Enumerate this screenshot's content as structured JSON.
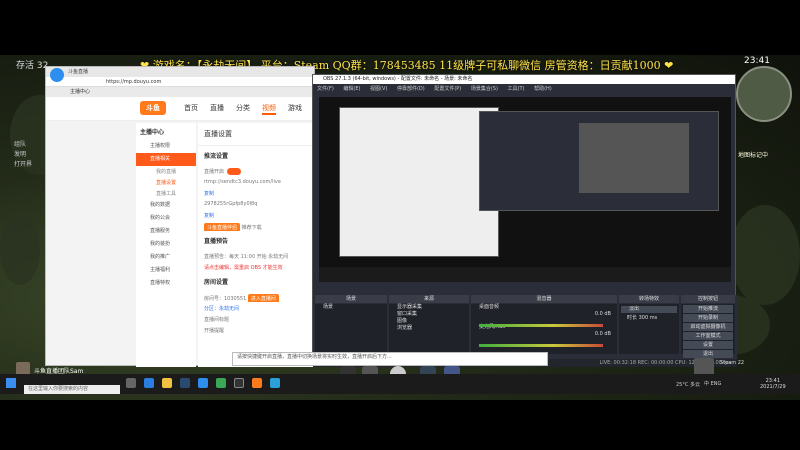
{
  "overlay": {
    "banner": "❤ 游戏名：【永劫无间】 平台：Steam QQ群：178453485 11级牌子可私聊微信 房管资格：日贡献1000 ❤"
  },
  "hud": {
    "top_left": "存活 32",
    "clock": "23:41",
    "right_note": "地图标记中",
    "left_lines": [
      "组队",
      "发明",
      "打开界"
    ]
  },
  "browser": {
    "title": "斗鱼直播",
    "url": "https://mp.douyu.com",
    "tab": "主播中心",
    "nav": [
      "首页",
      "直播",
      "分类",
      "视频",
      "游戏"
    ],
    "active_nav_index": 3,
    "logo": "斗鱼",
    "side_title": "主播中心",
    "side_items": [
      "主播权限",
      "直播相关",
      "我的数据",
      "我的公会",
      "直播服务",
      "我的装扮",
      "我的推广",
      "主播福利",
      "直播特权"
    ],
    "side_subs": [
      "我的直播",
      "直播设置",
      "直播工具"
    ],
    "content_title": "直播设置",
    "sec1": "推流设置",
    "rows": [
      "直播开启",
      "rtmp://sendtc3.douyu.com/live",
      "复制",
      "2978255rGpfp8y0l8q",
      "复制",
      "斗鱼直播伴侣",
      "推荐下载"
    ],
    "sec2": "直播预告",
    "row2": "直播预告：每天 11:00 开始 永劫无间",
    "warn": "请点击编辑，需重启 OBS 才能生效",
    "sec3": "房间设置",
    "row3a": "房间号：1030551",
    "btn3": "进入直播间",
    "row3b": "分区：永劫无间",
    "row3c": "直播间标题",
    "row3d": "开播提醒"
  },
  "obs": {
    "title": "OBS 27.1.3 (64-bit, windows) - 配置文件: 未命名 - 场景: 未命名",
    "menu": [
      "文件(F)",
      "编辑(E)",
      "视图(V)",
      "停靠部件(D)",
      "配置文件(P)",
      "场景集合(S)",
      "工具(T)",
      "帮助(H)"
    ],
    "docks": [
      "场景",
      "来源",
      "混音器",
      "转场特效",
      "控制按钮"
    ],
    "scene": "场景",
    "sources": [
      "显示器采集",
      "窗口采集",
      "图像",
      "浏览器"
    ],
    "controls": [
      "开始推流",
      "开始录制",
      "启动虚拟摄像机",
      "工作室模式",
      "设置",
      "退出"
    ],
    "mixer_channels": [
      "桌面音频",
      "麦克风/Aux"
    ],
    "mixer_levels": [
      "0.0 dB",
      "0.0 dB"
    ],
    "transition": "淡出",
    "duration_label": "时长",
    "duration": "300 ms",
    "status": "LIVE: 00:32:18  REC: 00:00:00  CPU: 12.5%, 60.00 fps"
  },
  "tooltip": "请按快捷键开启直播，直播中切换场景将实时生效，直播开启后下方...",
  "taskbar": {
    "user": "斗鱼直播团队Sam",
    "search": "在这里输入你要搜索的内容",
    "weather": "25°C 多云",
    "tray": "中 ENG",
    "time": "23:41",
    "date": "2021/7/29",
    "right_label": "Steam 22"
  },
  "colors": {
    "accent": "#ff5a1a",
    "banner": "#ffe24a",
    "obs_bg": "#2b2e38"
  }
}
